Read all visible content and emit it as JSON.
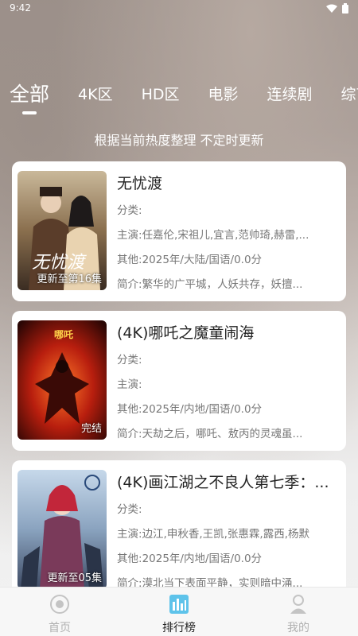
{
  "status_bar": {
    "time": "9:42"
  },
  "tabs": [
    "全部",
    "4K区",
    "HD区",
    "电影",
    "连续剧",
    "综艺"
  ],
  "subtitle": "根据当前热度整理 不定时更新",
  "labels": {
    "category": "分类:",
    "cast": "主演:",
    "other": "其他:",
    "intro": "简介:"
  },
  "items": [
    {
      "title": "无忧渡",
      "category": "",
      "cast": "任嘉伦,宋祖儿,宜言,范帅琦,赫雷,...",
      "other": "2025年/大陆/国语/0.0分",
      "intro": "繁华的广平城，人妖共存，妖擅...",
      "status": "更新至第16集"
    },
    {
      "title": "(4K)哪吒之魔童闹海",
      "category": "",
      "cast": "",
      "other": "2025年/内地/国语/0.0分",
      "intro": "天劫之后，哪吒、敖丙的灵魂虽...",
      "status": "完结"
    },
    {
      "title": "(4K)画江湖之不良人第七季：...",
      "category": "",
      "cast": "边江,申秋香,王凯,张惠霖,露西,杨默",
      "other": "2025年/内地/国语/0.0分",
      "intro": "漠北当下表面平静，实则暗中涌...",
      "status": "更新至05集"
    }
  ],
  "bottom_nav": [
    {
      "label": "首页",
      "icon": "home-icon"
    },
    {
      "label": "排行榜",
      "icon": "ranking-icon"
    },
    {
      "label": "我的",
      "icon": "profile-icon"
    }
  ],
  "colors": {
    "active_text": "#222222",
    "inactive_text": "#b0b0b0",
    "ranking_icon": "#5ec3ea"
  }
}
